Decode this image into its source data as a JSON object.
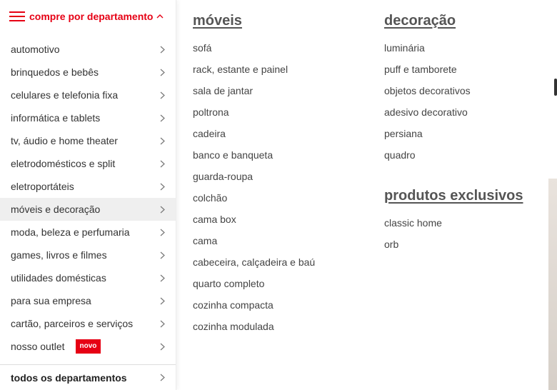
{
  "header": {
    "title": "compre por departamento"
  },
  "sidebar": {
    "items": [
      {
        "label": "automotivo"
      },
      {
        "label": "brinquedos e bebês"
      },
      {
        "label": "celulares e telefonia fixa"
      },
      {
        "label": "informática e tablets"
      },
      {
        "label": "tv, áudio e home theater"
      },
      {
        "label": "eletrodomésticos e split"
      },
      {
        "label": "eletroportáteis"
      },
      {
        "label": "móveis e decoração",
        "active": true
      },
      {
        "label": "moda, beleza e perfumaria"
      },
      {
        "label": "games, livros e filmes"
      },
      {
        "label": "utilidades domésticas"
      },
      {
        "label": "para sua empresa"
      },
      {
        "label": "cartão, parceiros e serviços"
      },
      {
        "label": "nosso outlet",
        "badge": "novo"
      }
    ],
    "footer": "todos os departamentos"
  },
  "panel": {
    "moveis": {
      "title": "móveis",
      "items": [
        "sofá",
        "rack, estante e painel",
        "sala de jantar",
        "poltrona",
        "cadeira",
        "banco e banqueta",
        "guarda-roupa",
        "colchão",
        "cama box",
        "cama",
        "cabeceira, calçadeira e baú",
        "quarto completo",
        "cozinha compacta",
        "cozinha modulada"
      ]
    },
    "decoracao": {
      "title": "decoração",
      "items": [
        "luminária",
        "puff e tamborete",
        "objetos decorativos",
        "adesivo decorativo",
        "persiana",
        "quadro"
      ]
    },
    "exclusivos": {
      "title": "produtos exclusivos",
      "items": [
        "classic home",
        "orb"
      ]
    }
  },
  "colors": {
    "accent": "#e60014",
    "active_bg": "#efefef"
  },
  "icons": {
    "menu": "hamburger-icon",
    "collapse": "chevron-up-icon",
    "item": "chevron-right-icon"
  }
}
